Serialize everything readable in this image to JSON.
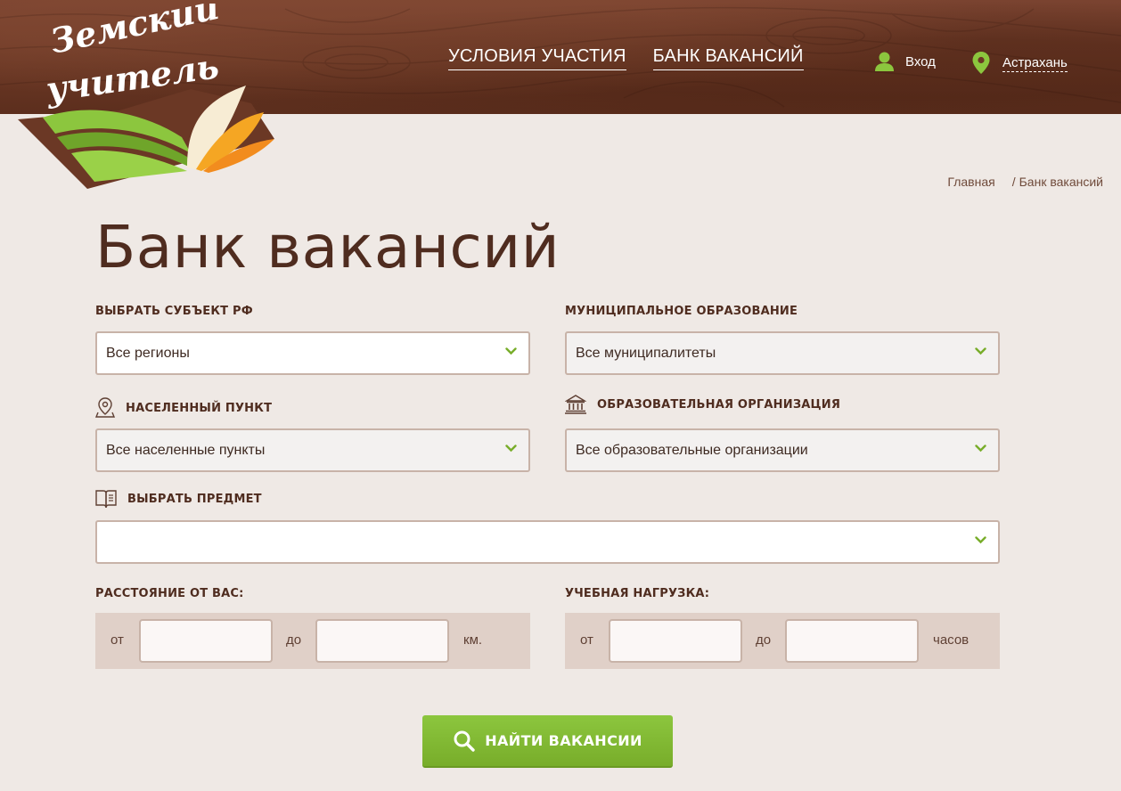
{
  "header": {
    "logo_text_line1": "Земский",
    "logo_text_line2": "учитель",
    "nav": [
      {
        "label": "УСЛОВИЯ УЧАСТИЯ"
      },
      {
        "label": "БАНК ВАКАНСИЙ"
      }
    ],
    "login_label": "Вход",
    "city_label": "Астрахань",
    "colors": {
      "accent_green": "#8cc63e",
      "header_brown": "#6b3825"
    }
  },
  "breadcrumb": {
    "home": "Главная",
    "separator": "/",
    "current": "Банк вакансий"
  },
  "page": {
    "title": "Банк вакансий"
  },
  "form": {
    "region": {
      "label": "ВЫБРАТЬ СУБЪЕКТ РФ",
      "value": "Все регионы"
    },
    "municipality": {
      "label": "МУНИЦИПАЛЬНОЕ ОБРАЗОВАНИЕ",
      "value": "Все муниципалитеты"
    },
    "locality": {
      "label": "НАСЕЛЕННЫЙ ПУНКТ",
      "value": "Все населенные пункты",
      "icon": "map-pin-icon"
    },
    "organization": {
      "label": "ОБРАЗОВАТЕЛЬНАЯ ОРГАНИЗАЦИЯ",
      "value": "Все образовательные организации",
      "icon": "institution-icon"
    },
    "subject": {
      "label": "ВЫБРАТЬ ПРЕДМЕТ",
      "value": "",
      "icon": "book-icon"
    },
    "distance": {
      "label": "РАССТОЯНИЕ ОТ ВАС:",
      "from": "от",
      "to": "до",
      "unit": "км."
    },
    "workload": {
      "label": "УЧЕБНАЯ НАГРУЗКА:",
      "from": "от",
      "to": "до",
      "unit": "часов"
    },
    "submit_label": "НАЙТИ ВАКАНСИИ"
  }
}
